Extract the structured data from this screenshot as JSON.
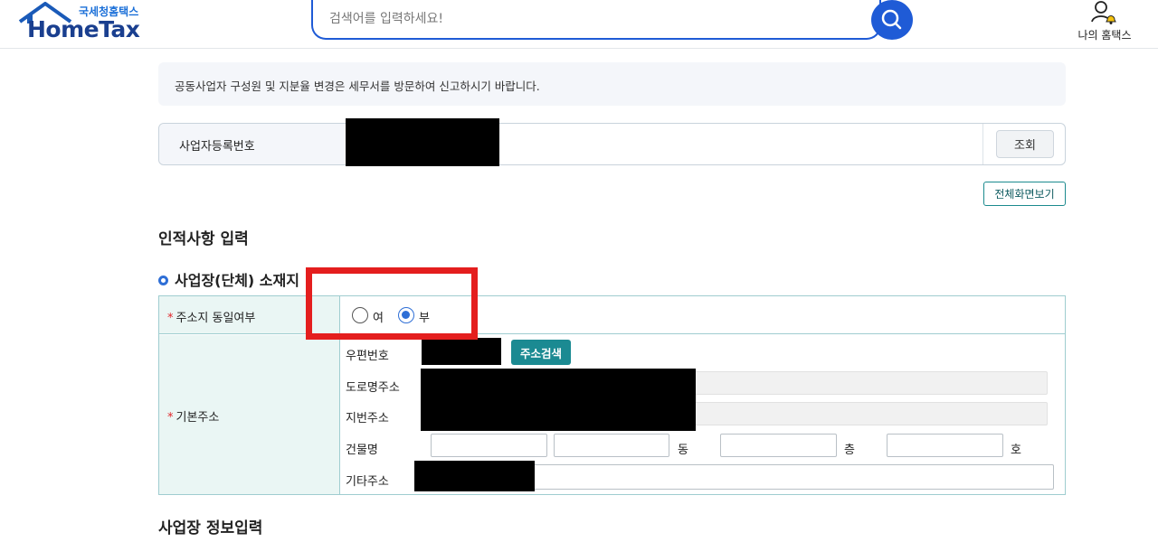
{
  "header": {
    "logo_sub": "국세청홈택스",
    "logo_main": "HomeTax",
    "search_placeholder": "검색어를 입력하세요!",
    "my_hometax_label": "나의 홈택스",
    "brand_color": "#1f5bd6"
  },
  "notice": {
    "text": "공동사업자 구성원 및 지분율 변경은 세무서를 방문하여 신고하시기 바랍니다."
  },
  "business_number": {
    "label": "사업자등록번호",
    "lookup_button": "조회"
  },
  "full_view_button": "전체화면보기",
  "section_title": "인적사항 입력",
  "subsection_title": "사업장(단체) 소재지",
  "form": {
    "same_address": {
      "label": "주소지 동일여부",
      "options": [
        {
          "label": "여",
          "checked": false
        },
        {
          "label": "부",
          "checked": true
        }
      ]
    },
    "basic_address": {
      "label": "기본주소",
      "postal_code_label": "우편번호",
      "address_search_button": "주소검색",
      "road_address_label": "도로명주소",
      "lot_address_label": "지번주소",
      "building_label": "건물명",
      "dong_label": "동",
      "floor_label": "층",
      "ho_label": "호",
      "other_address_label": "기타주소"
    },
    "required_mark": "*"
  },
  "next_section_title": "사업장 정보입력",
  "colors": {
    "accent_teal": "#1b8a92",
    "table_header_bg": "#eaf6f4",
    "highlight_red": "#e41e1e",
    "radio_blue": "#2f6fd6"
  }
}
